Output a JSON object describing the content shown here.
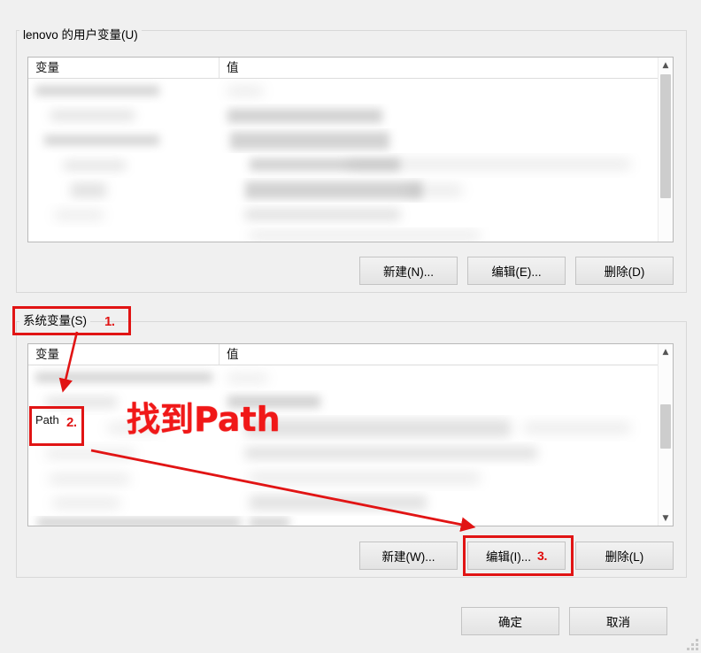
{
  "dialog": {
    "user_group_label": "lenovo 的用户变量(U)",
    "system_group_label": "系统变量(S)"
  },
  "columns": {
    "name": "变量",
    "value": "值"
  },
  "user_variables": {
    "buttons": [
      {
        "label": "新建(N)...",
        "name": "user-new-button"
      },
      {
        "label": "编辑(E)...",
        "name": "user-edit-button"
      },
      {
        "label": "删除(D)",
        "name": "user-delete-button"
      }
    ],
    "scrollbar": {
      "up_icon": "chevron-up-icon",
      "down_icon": ""
    },
    "rows_obscured": true,
    "row_count": 6
  },
  "system_variables": {
    "buttons": [
      {
        "label": "新建(W)...",
        "name": "system-new-button"
      },
      {
        "label": "编辑(I)...",
        "name": "system-edit-button",
        "marker": "3."
      },
      {
        "label": "删除(L)",
        "name": "system-delete-button"
      }
    ],
    "scrollbar": {
      "up_icon": "chevron-up-icon",
      "down_icon": "chevron-down-icon"
    },
    "highlighted_row": "Path",
    "rows_obscured": true,
    "row_count": 7
  },
  "dialog_buttons": [
    {
      "label": "确定",
      "name": "ok-button"
    },
    {
      "label": "取消",
      "name": "cancel-button"
    }
  ],
  "annotations": {
    "accent_color": "#e11414",
    "step1_number": "1.",
    "step2_number": "2.",
    "step3_number": "3.",
    "callout_text": "找到Path",
    "path_label": "Path"
  }
}
